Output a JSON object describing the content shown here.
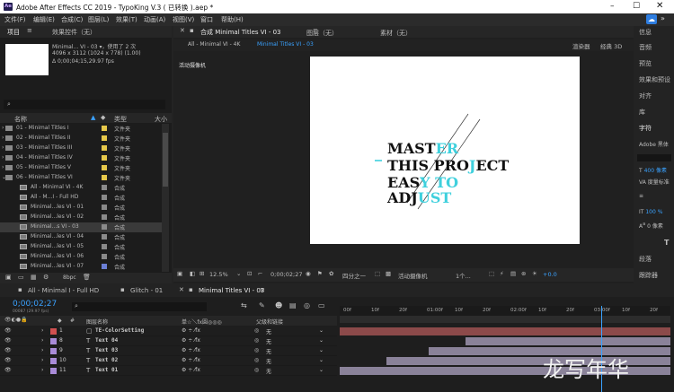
{
  "window": {
    "app_icon": "Ae",
    "title": "Adobe After Effects CC 2019 - TypoKing V.3 ( 已转换 ).aep *"
  },
  "menu": [
    "文件(F)",
    "编辑(E)",
    "合成(C)",
    "图层(L)",
    "效果(T)",
    "动画(A)",
    "视图(V)",
    "窗口",
    "帮助(H)"
  ],
  "project": {
    "tab_project": "项目",
    "tab_effects": "效果控件（无）",
    "selected_name": "Minimal... VI - 03 ▾，使用了 2 次",
    "selected_size": "4096 x 3112 (1024 x 778) (1.00)",
    "selected_duration": "Δ 0;00;04;15,29.97 fps",
    "search_icon": "search-icon",
    "columns": {
      "name": "名称",
      "type": "类型",
      "size": "大小"
    },
    "rows": [
      {
        "name": "01 - Minimal Titles I",
        "type": "文件夹",
        "kind": "folder",
        "color": "#e6c84a"
      },
      {
        "name": "02 - Minimal Titles II",
        "type": "文件夹",
        "kind": "folder",
        "color": "#e6c84a"
      },
      {
        "name": "03 - Minimal Titles III",
        "type": "文件夹",
        "kind": "folder",
        "color": "#e6c84a"
      },
      {
        "name": "04 - Minimal Titles IV",
        "type": "文件夹",
        "kind": "folder",
        "color": "#e6c84a"
      },
      {
        "name": "05 - Minimal Titles V",
        "type": "文件夹",
        "kind": "folder",
        "color": "#e6c84a"
      },
      {
        "name": "06 - Minimal Titles VI",
        "type": "文件夹",
        "kind": "folder",
        "color": "#e6c84a"
      },
      {
        "name": "All - Minimal VI - 4K",
        "type": "合成",
        "kind": "comp",
        "color": "#8a8a8a"
      },
      {
        "name": "All - M...I - Full HD",
        "type": "合成",
        "kind": "comp",
        "color": "#8a8a8a"
      },
      {
        "name": "Minimal...les VI - 01",
        "type": "合成",
        "kind": "comp",
        "color": "#8a8a8a"
      },
      {
        "name": "Minimal...les VI - 02",
        "type": "合成",
        "kind": "comp",
        "color": "#8a8a8a"
      },
      {
        "name": "Minimal...s VI - 03",
        "type": "合成",
        "kind": "comp",
        "color": "#8a8a8a"
      },
      {
        "name": "Minimal...les VI - 04",
        "type": "合成",
        "kind": "comp",
        "color": "#8a8a8a"
      },
      {
        "name": "Minimal...les VI - 05",
        "type": "合成",
        "kind": "comp",
        "color": "#8a8a8a"
      },
      {
        "name": "Minimal...les VI - 06",
        "type": "合成",
        "kind": "comp",
        "color": "#8a8a8a"
      },
      {
        "name": "Minimal...les VI - 07",
        "type": "合成",
        "kind": "comp",
        "color": "#6b7fd6"
      }
    ],
    "bpc": "8bpc"
  },
  "composition": {
    "tab": "合成 Minimal Titles VI - 03",
    "layer_tab": "图层（无）",
    "footage_tab": "素材（无）",
    "crumb1": "All - Minimal VI - 4K",
    "crumb2": "Minimal Titles VI - 03",
    "renderer": "渲染器",
    "renderer_value": "经典 3D",
    "camera_label": "活动摄像机",
    "art": {
      "line1": "MASTER",
      "line2": "THIS PROJECT",
      "line3": "EASY TO",
      "line4": "ADJUST",
      "accent": "#3fd0dd"
    },
    "footer": {
      "zoom": "12.5%",
      "timecode": "0;00;02;27",
      "resolution": "四分之一",
      "camera": "活动摄像机",
      "views": "1个...",
      "exposure": "+0.0"
    }
  },
  "timeline": {
    "tabs": [
      "All - Minimal I - Full HD",
      "Glitch - 01",
      "Minimal Titles VI - 03"
    ],
    "timecode": "0;00;02;27",
    "timecode_sub": "00087 (29.97 fps)",
    "col_name": "图层名称",
    "col_switches": "单☆＼fx圓◎◎◎",
    "col_parent": "父级和链接",
    "layers": [
      {
        "num": "1",
        "name": "TE-ColorSetting",
        "type": "solid",
        "label": "#d05050",
        "parent": "无"
      },
      {
        "num": "8",
        "name": "Text 04",
        "type": "text",
        "label": "#a98bd8",
        "parent": "无"
      },
      {
        "num": "9",
        "name": "Text 03",
        "type": "text",
        "label": "#a98bd8",
        "parent": "无"
      },
      {
        "num": "10",
        "name": "Text 02",
        "type": "text",
        "label": "#a98bd8",
        "parent": "无"
      },
      {
        "num": "11",
        "name": "Text 01",
        "type": "text",
        "label": "#a98bd8",
        "parent": "无"
      }
    ],
    "ruler": [
      "00f",
      "10f",
      "20f",
      "01:00f",
      "10f",
      "20f",
      "02:00f",
      "10f",
      "20f",
      "03:00f",
      "10f",
      "20f"
    ],
    "bars": [
      {
        "start": 0.0,
        "end": 1.0,
        "color": "#8c4a4a"
      },
      {
        "start": 0.38,
        "end": 1.0,
        "color": "#8a8299"
      },
      {
        "start": 0.27,
        "end": 1.0,
        "color": "#8a8299"
      },
      {
        "start": 0.14,
        "end": 1.0,
        "color": "#8a8299"
      },
      {
        "start": 0.0,
        "end": 1.0,
        "color": "#8a8299"
      }
    ],
    "playhead": 0.79
  },
  "right_panel": [
    "信息",
    "音频",
    "预览",
    "效果和预设",
    "对齐",
    "库",
    "字符",
    "Adobe 黑体",
    "400 像素",
    "度量标准",
    "100 %",
    "0 像素",
    "段落",
    "跟踪器"
  ],
  "watermark": "龙写年华"
}
